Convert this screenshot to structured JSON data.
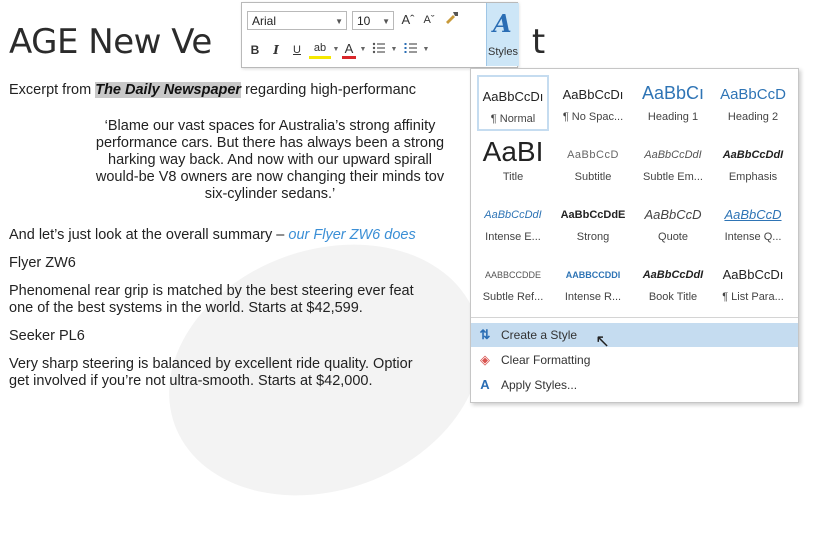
{
  "document": {
    "title_left": "AGE New Ve",
    "title_right": "t",
    "intro_prefix": "Excerpt from ",
    "intro_highlight": "The Daily Newspaper",
    "intro_suffix": " regarding high-performanc",
    "quote_lines": [
      "‘Blame our vast spaces for Australia’s strong affinity",
      "performance cars. But there has always been a strong",
      "harking way back. And now with our upward spirall",
      "would-be V8 owners are now changing their minds tov",
      "six-cylinder sedans.’"
    ],
    "summary_prefix": "And let’s just look at the overall summary – ",
    "summary_link": "our Flyer ZW6 does",
    "heading1": "Flyer ZW6",
    "para1_line1": "Phenomenal rear grip is matched by the best steering ever feat",
    "para1_line2": "one of the best systems in the world. Starts at $42,599.",
    "heading2": "Seeker PL6",
    "para2_line1": "Very sharp steering is balanced by excellent ride quality. Optior",
    "para2_line2": "get involved if you’re not ultra-smooth. Starts at $42,000."
  },
  "mini_toolbar": {
    "font_name": "Arial",
    "font_size": "10",
    "grow_font": "Aˆ",
    "shrink_font": "Aˇ",
    "bold": "B",
    "italic": "I",
    "underline": "U",
    "highlight": "ab",
    "font_color": "A",
    "styles_label": "Styles"
  },
  "styles_gallery": {
    "tiles": [
      {
        "sample": "AaBbCcDı",
        "name": "¶ Normal"
      },
      {
        "sample": "AaBbCcDı",
        "name": "¶ No Spac..."
      },
      {
        "sample": "AaBbCı",
        "name": "Heading 1"
      },
      {
        "sample": "AaBbCcD",
        "name": "Heading 2"
      },
      {
        "sample": "AaBI",
        "name": "Title"
      },
      {
        "sample": "AaBbCcD",
        "name": "Subtitle"
      },
      {
        "sample": "AaBbCcDdI",
        "name": "Subtle Em..."
      },
      {
        "sample": "AaBbCcDdI",
        "name": "Emphasis"
      },
      {
        "sample": "AaBbCcDdI",
        "name": "Intense E..."
      },
      {
        "sample": "AaBbCcDdE",
        "name": "Strong"
      },
      {
        "sample": "AaBbCcD",
        "name": "Quote"
      },
      {
        "sample": "AaBbCcD",
        "name": "Intense Q..."
      },
      {
        "sample": "AABBCCDDE",
        "name": "Subtle Ref..."
      },
      {
        "sample": "AABBCCDDI",
        "name": "Intense R..."
      },
      {
        "sample": "AaBbCcDdI",
        "name": "Book Title"
      },
      {
        "sample": "AaBbCcDı",
        "name": "¶ List Para..."
      }
    ],
    "commands": {
      "create_style": "Create a Style",
      "clear_formatting": "Clear Formatting",
      "apply_styles": "Apply Styles..."
    }
  },
  "colors": {
    "accent_blue": "#2a6db4",
    "link_blue": "#3b8fd6",
    "hover": "#c5dcf0"
  }
}
